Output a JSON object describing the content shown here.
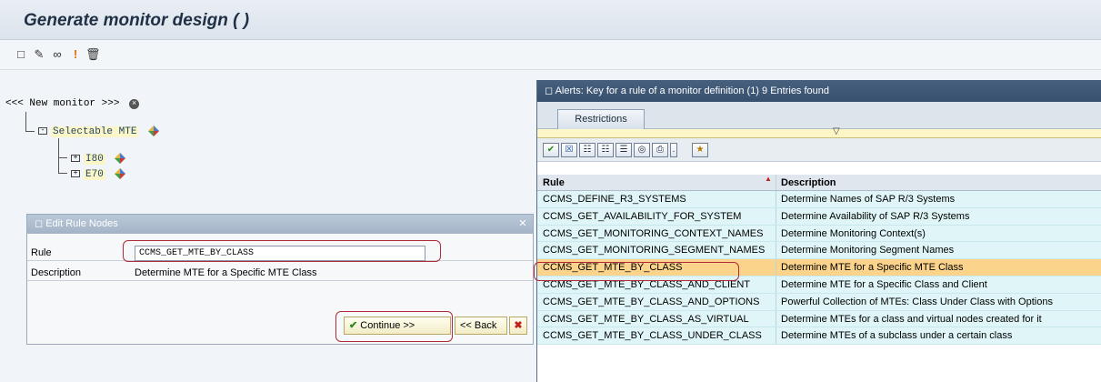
{
  "window": {
    "title": "Generate monitor design (  )"
  },
  "toolbar": {
    "icons": [
      "new-document-icon",
      "edit-pencil-icon",
      "glasses-icon",
      "exclamation-icon",
      "delete-icon"
    ]
  },
  "tree": {
    "root_label": "<<< New monitor >>>",
    "child_label": "Selectable MTE",
    "leaves": [
      "I80",
      "E70"
    ]
  },
  "edit_dialog": {
    "title": "Edit Rule Nodes",
    "rule_label": "Rule",
    "rule_value": "CCMS_GET_MTE_BY_CLASS",
    "description_label": "Description",
    "description_value": "Determine MTE for a Specific MTE Class",
    "continue_label": "Continue >>",
    "back_label": "<< Back"
  },
  "alerts_popup": {
    "title": "Alerts: Key for a rule of a monitor definition (1)   9 Entries found",
    "tab_label": "Restrictions",
    "columns": [
      "Rule",
      "Description"
    ],
    "rows": [
      [
        "CCMS_DEFINE_R3_SYSTEMS",
        "Determine Names of SAP R/3 Systems"
      ],
      [
        "CCMS_GET_AVAILABILITY_FOR_SYSTEM",
        "Determine Availability of SAP R/3 Systems"
      ],
      [
        "CCMS_GET_MONITORING_CONTEXT_NAMES",
        "Determine Monitoring Context(s)"
      ],
      [
        "CCMS_GET_MONITORING_SEGMENT_NAMES",
        "Determine Monitoring Segment Names"
      ],
      [
        "CCMS_GET_MTE_BY_CLASS",
        "Determine MTE for a Specific MTE Class"
      ],
      [
        "CCMS_GET_MTE_BY_CLASS_AND_CLIENT",
        "Determine MTE for a Specific Class and Client"
      ],
      [
        "CCMS_GET_MTE_BY_CLASS_AND_OPTIONS",
        "Powerful Collection of MTEs: Class Under Class with Options"
      ],
      [
        "CCMS_GET_MTE_BY_CLASS_AS_VIRTUAL",
        "Determine MTEs for a class and virtual nodes created for it"
      ],
      [
        "CCMS_GET_MTE_BY_CLASS_UNDER_CLASS",
        "Determine MTEs of a subclass under a certain class"
      ]
    ],
    "selected_row": 4
  },
  "colors": {
    "selected_row": "#fbd38b",
    "row_bg": "#dff5f7",
    "header_bg": "#36506e",
    "highlight": "#b02a3a"
  }
}
